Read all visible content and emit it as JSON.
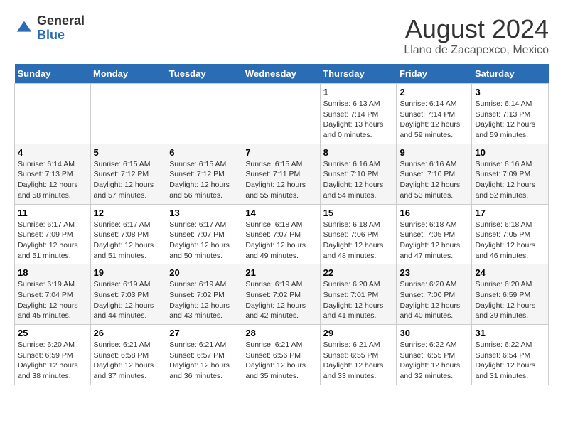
{
  "logo": {
    "general": "General",
    "blue": "Blue"
  },
  "header": {
    "title": "August 2024",
    "subtitle": "Llano de Zacapexco, Mexico"
  },
  "days_of_week": [
    "Sunday",
    "Monday",
    "Tuesday",
    "Wednesday",
    "Thursday",
    "Friday",
    "Saturday"
  ],
  "weeks": [
    [
      {
        "day": "",
        "sunrise": "",
        "sunset": "",
        "daylight": ""
      },
      {
        "day": "",
        "sunrise": "",
        "sunset": "",
        "daylight": ""
      },
      {
        "day": "",
        "sunrise": "",
        "sunset": "",
        "daylight": ""
      },
      {
        "day": "",
        "sunrise": "",
        "sunset": "",
        "daylight": ""
      },
      {
        "day": "1",
        "sunrise": "Sunrise: 6:13 AM",
        "sunset": "Sunset: 7:14 PM",
        "daylight": "Daylight: 13 hours and 0 minutes."
      },
      {
        "day": "2",
        "sunrise": "Sunrise: 6:14 AM",
        "sunset": "Sunset: 7:14 PM",
        "daylight": "Daylight: 12 hours and 59 minutes."
      },
      {
        "day": "3",
        "sunrise": "Sunrise: 6:14 AM",
        "sunset": "Sunset: 7:13 PM",
        "daylight": "Daylight: 12 hours and 59 minutes."
      }
    ],
    [
      {
        "day": "4",
        "sunrise": "Sunrise: 6:14 AM",
        "sunset": "Sunset: 7:13 PM",
        "daylight": "Daylight: 12 hours and 58 minutes."
      },
      {
        "day": "5",
        "sunrise": "Sunrise: 6:15 AM",
        "sunset": "Sunset: 7:12 PM",
        "daylight": "Daylight: 12 hours and 57 minutes."
      },
      {
        "day": "6",
        "sunrise": "Sunrise: 6:15 AM",
        "sunset": "Sunset: 7:12 PM",
        "daylight": "Daylight: 12 hours and 56 minutes."
      },
      {
        "day": "7",
        "sunrise": "Sunrise: 6:15 AM",
        "sunset": "Sunset: 7:11 PM",
        "daylight": "Daylight: 12 hours and 55 minutes."
      },
      {
        "day": "8",
        "sunrise": "Sunrise: 6:16 AM",
        "sunset": "Sunset: 7:10 PM",
        "daylight": "Daylight: 12 hours and 54 minutes."
      },
      {
        "day": "9",
        "sunrise": "Sunrise: 6:16 AM",
        "sunset": "Sunset: 7:10 PM",
        "daylight": "Daylight: 12 hours and 53 minutes."
      },
      {
        "day": "10",
        "sunrise": "Sunrise: 6:16 AM",
        "sunset": "Sunset: 7:09 PM",
        "daylight": "Daylight: 12 hours and 52 minutes."
      }
    ],
    [
      {
        "day": "11",
        "sunrise": "Sunrise: 6:17 AM",
        "sunset": "Sunset: 7:09 PM",
        "daylight": "Daylight: 12 hours and 51 minutes."
      },
      {
        "day": "12",
        "sunrise": "Sunrise: 6:17 AM",
        "sunset": "Sunset: 7:08 PM",
        "daylight": "Daylight: 12 hours and 51 minutes."
      },
      {
        "day": "13",
        "sunrise": "Sunrise: 6:17 AM",
        "sunset": "Sunset: 7:07 PM",
        "daylight": "Daylight: 12 hours and 50 minutes."
      },
      {
        "day": "14",
        "sunrise": "Sunrise: 6:18 AM",
        "sunset": "Sunset: 7:07 PM",
        "daylight": "Daylight: 12 hours and 49 minutes."
      },
      {
        "day": "15",
        "sunrise": "Sunrise: 6:18 AM",
        "sunset": "Sunset: 7:06 PM",
        "daylight": "Daylight: 12 hours and 48 minutes."
      },
      {
        "day": "16",
        "sunrise": "Sunrise: 6:18 AM",
        "sunset": "Sunset: 7:05 PM",
        "daylight": "Daylight: 12 hours and 47 minutes."
      },
      {
        "day": "17",
        "sunrise": "Sunrise: 6:18 AM",
        "sunset": "Sunset: 7:05 PM",
        "daylight": "Daylight: 12 hours and 46 minutes."
      }
    ],
    [
      {
        "day": "18",
        "sunrise": "Sunrise: 6:19 AM",
        "sunset": "Sunset: 7:04 PM",
        "daylight": "Daylight: 12 hours and 45 minutes."
      },
      {
        "day": "19",
        "sunrise": "Sunrise: 6:19 AM",
        "sunset": "Sunset: 7:03 PM",
        "daylight": "Daylight: 12 hours and 44 minutes."
      },
      {
        "day": "20",
        "sunrise": "Sunrise: 6:19 AM",
        "sunset": "Sunset: 7:02 PM",
        "daylight": "Daylight: 12 hours and 43 minutes."
      },
      {
        "day": "21",
        "sunrise": "Sunrise: 6:19 AM",
        "sunset": "Sunset: 7:02 PM",
        "daylight": "Daylight: 12 hours and 42 minutes."
      },
      {
        "day": "22",
        "sunrise": "Sunrise: 6:20 AM",
        "sunset": "Sunset: 7:01 PM",
        "daylight": "Daylight: 12 hours and 41 minutes."
      },
      {
        "day": "23",
        "sunrise": "Sunrise: 6:20 AM",
        "sunset": "Sunset: 7:00 PM",
        "daylight": "Daylight: 12 hours and 40 minutes."
      },
      {
        "day": "24",
        "sunrise": "Sunrise: 6:20 AM",
        "sunset": "Sunset: 6:59 PM",
        "daylight": "Daylight: 12 hours and 39 minutes."
      }
    ],
    [
      {
        "day": "25",
        "sunrise": "Sunrise: 6:20 AM",
        "sunset": "Sunset: 6:59 PM",
        "daylight": "Daylight: 12 hours and 38 minutes."
      },
      {
        "day": "26",
        "sunrise": "Sunrise: 6:21 AM",
        "sunset": "Sunset: 6:58 PM",
        "daylight": "Daylight: 12 hours and 37 minutes."
      },
      {
        "day": "27",
        "sunrise": "Sunrise: 6:21 AM",
        "sunset": "Sunset: 6:57 PM",
        "daylight": "Daylight: 12 hours and 36 minutes."
      },
      {
        "day": "28",
        "sunrise": "Sunrise: 6:21 AM",
        "sunset": "Sunset: 6:56 PM",
        "daylight": "Daylight: 12 hours and 35 minutes."
      },
      {
        "day": "29",
        "sunrise": "Sunrise: 6:21 AM",
        "sunset": "Sunset: 6:55 PM",
        "daylight": "Daylight: 12 hours and 33 minutes."
      },
      {
        "day": "30",
        "sunrise": "Sunrise: 6:22 AM",
        "sunset": "Sunset: 6:55 PM",
        "daylight": "Daylight: 12 hours and 32 minutes."
      },
      {
        "day": "31",
        "sunrise": "Sunrise: 6:22 AM",
        "sunset": "Sunset: 6:54 PM",
        "daylight": "Daylight: 12 hours and 31 minutes."
      }
    ]
  ]
}
